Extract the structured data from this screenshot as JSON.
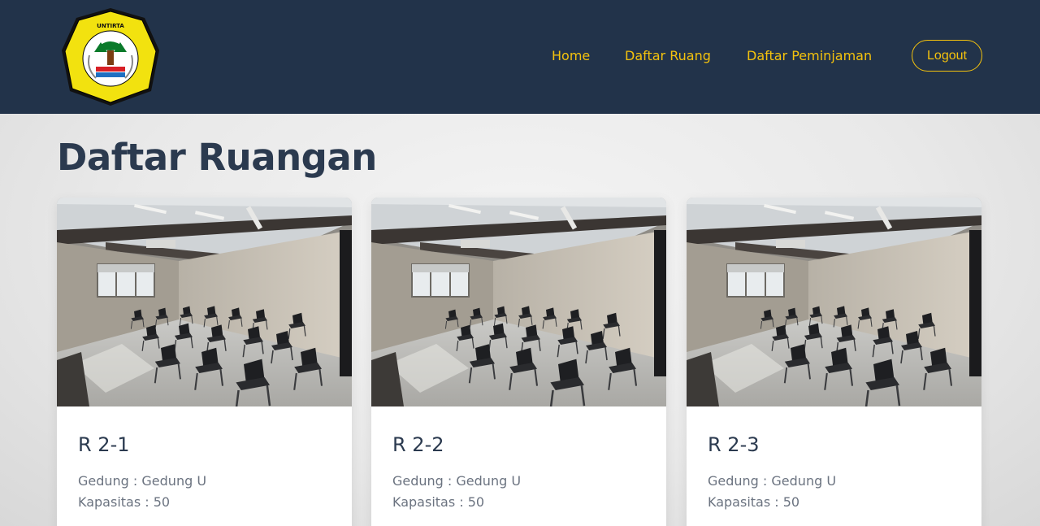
{
  "header": {
    "logo_text": "UNIVERSITAS SULTAN AGENG TIRTAYASA",
    "nav": [
      {
        "label": "Home"
      },
      {
        "label": "Daftar Ruang"
      },
      {
        "label": "Daftar Peminjaman"
      }
    ],
    "logout_label": "Logout"
  },
  "page": {
    "title": "Daftar Ruangan"
  },
  "rooms": [
    {
      "name": "R 2-1",
      "gedung": "Gedung : Gedung U",
      "kapasitas": "Kapasitas : 50"
    },
    {
      "name": "R 2-2",
      "gedung": "Gedung : Gedung U",
      "kapasitas": "Kapasitas : 50"
    },
    {
      "name": "R 2-3",
      "gedung": "Gedung : Gedung U",
      "kapasitas": "Kapasitas : 50"
    }
  ],
  "colors": {
    "navbar": "#22334a",
    "accent": "#f4c20d",
    "title": "#2b3a4f",
    "muted_text": "#6b7380"
  }
}
